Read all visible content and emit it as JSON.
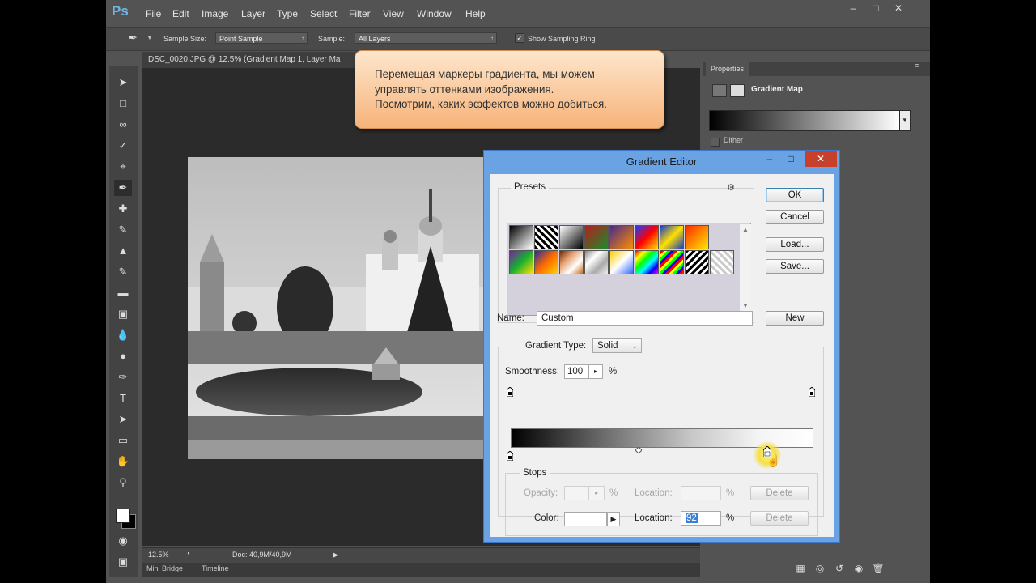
{
  "app": {
    "logo": "Ps"
  },
  "menu": [
    "File",
    "Edit",
    "Image",
    "Layer",
    "Type",
    "Select",
    "Filter",
    "View",
    "Window",
    "Help"
  ],
  "options_bar": {
    "sample_size_label": "Sample Size:",
    "sample_size_value": "Point Sample",
    "sample_label": "Sample:",
    "sample_value": "All Layers",
    "show_ring_label": "Show Sampling Ring",
    "show_ring_checked": true
  },
  "document": {
    "tab_title": "DSC_0020.JPG @ 12.5% (Gradient Map 1, Layer Ma",
    "zoom": "12.5%",
    "doc_size": "Doc: 40,9M/40,9M"
  },
  "bottom_tabs": [
    "Mini Bridge",
    "Timeline"
  ],
  "properties": {
    "tab": "Properties",
    "adjustment_name": "Gradient Map",
    "dither_label": "Dither"
  },
  "tooltip": {
    "lines": [
      "Перемещая маркеры градиента, мы можем",
      "управлять оттенками изображения.",
      "Посмотрим, каких эффектов можно добиться."
    ]
  },
  "gradient_editor": {
    "title": "Gradient Editor",
    "presets_label": "Presets",
    "buttons": {
      "ok": "OK",
      "cancel": "Cancel",
      "load": "Load...",
      "save": "Save...",
      "new": "New",
      "delete": "Delete"
    },
    "name_label": "Name:",
    "name_value": "Custom",
    "gradient_type_label": "Gradient Type:",
    "gradient_type_value": "Solid",
    "smoothness_label": "Smoothness:",
    "smoothness_value": "100",
    "percent": "%",
    "stops_label": "Stops",
    "opacity_label": "Opacity:",
    "location_label": "Location:",
    "color_label": "Color:",
    "location_value": "92",
    "preset_colors": [
      [
        "#000/#fff",
        "checker",
        "#000/#fff",
        "#b3201e/#1d8a2c",
        "#4a2b89/#ff8c00",
        "#1c3cff/#ff0000",
        "#1a3cc8/#ffe000",
        "#ff2a00/#ffe600"
      ],
      [
        "#7a1fa2/#17b12f",
        "#2a2a9a/#ffd000",
        "#c86b1a/#fff",
        "#e0e0e0/#a0a0a0",
        "#3366ff/#ffcc00",
        "rainbow",
        "rainbow-diag",
        "stripes",
        "checker"
      ]
    ]
  }
}
